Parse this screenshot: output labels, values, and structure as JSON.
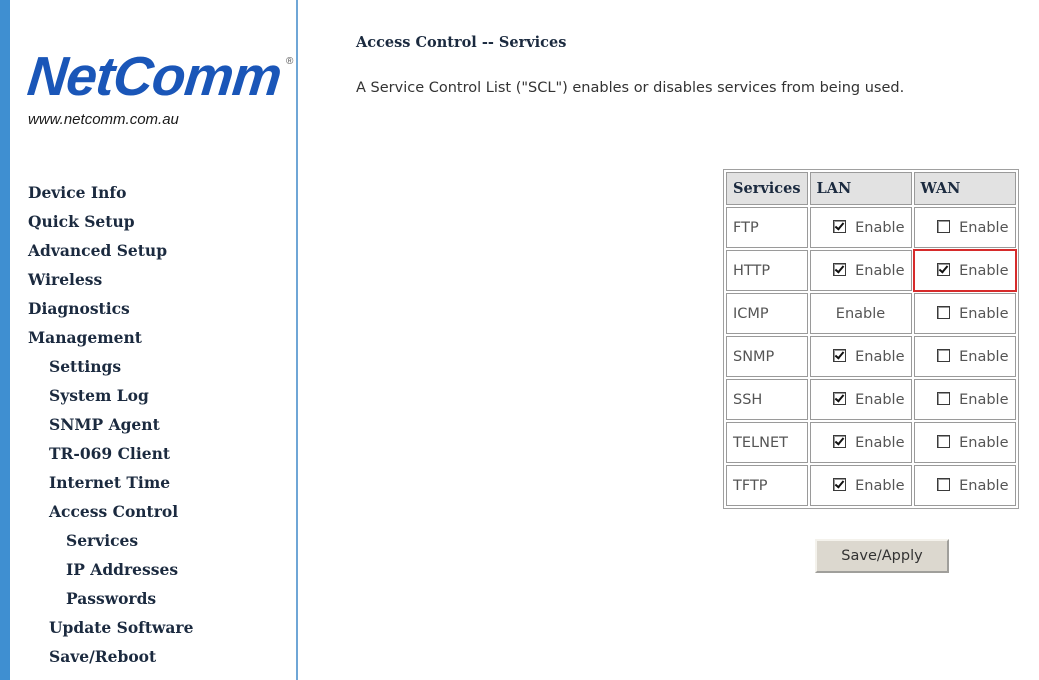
{
  "brand": {
    "logo_text": "NetComm",
    "registered": "®",
    "url": "www.netcomm.com.au"
  },
  "nav": {
    "items": [
      {
        "label": "Device Info"
      },
      {
        "label": "Quick Setup"
      },
      {
        "label": "Advanced Setup"
      },
      {
        "label": "Wireless"
      },
      {
        "label": "Diagnostics"
      },
      {
        "label": "Management"
      },
      {
        "label": "Settings"
      },
      {
        "label": "System Log"
      },
      {
        "label": "SNMP Agent"
      },
      {
        "label": "TR-069 Client"
      },
      {
        "label": "Internet Time"
      },
      {
        "label": "Access Control"
      },
      {
        "label": "Services"
      },
      {
        "label": "IP Addresses"
      },
      {
        "label": "Passwords"
      },
      {
        "label": "Update Software"
      },
      {
        "label": "Save/Reboot"
      }
    ]
  },
  "page": {
    "title": "Access Control -- Services",
    "description": "A Service Control List (\"SCL\") enables or disables services from being used."
  },
  "table": {
    "headers": [
      "Services",
      "LAN",
      "WAN"
    ],
    "rows": [
      {
        "service": "FTP",
        "lan_label": "Enable",
        "lan_checked": true,
        "wan_label": "Enable",
        "wan_checked": false
      },
      {
        "service": "HTTP",
        "lan_label": "Enable",
        "lan_checked": true,
        "wan_label": "Enable",
        "wan_checked": true
      },
      {
        "service": "ICMP",
        "lan_label": "Enable",
        "lan_checked": null,
        "wan_label": "Enable",
        "wan_checked": false
      },
      {
        "service": "SNMP",
        "lan_label": "Enable",
        "lan_checked": true,
        "wan_label": "Enable",
        "wan_checked": false
      },
      {
        "service": "SSH",
        "lan_label": "Enable",
        "lan_checked": true,
        "wan_label": "Enable",
        "wan_checked": false
      },
      {
        "service": "TELNET",
        "lan_label": "Enable",
        "lan_checked": true,
        "wan_label": "Enable",
        "wan_checked": false
      },
      {
        "service": "TFTP",
        "lan_label": "Enable",
        "lan_checked": true,
        "wan_label": "Enable",
        "wan_checked": false
      }
    ]
  },
  "actions": {
    "save_label": "Save/Apply"
  },
  "colors": {
    "sidebar_stripe": "#3f8fd1",
    "logo": "#1a56b8",
    "highlight": "#d62b2b",
    "header_bg": "#e2e2e2"
  }
}
